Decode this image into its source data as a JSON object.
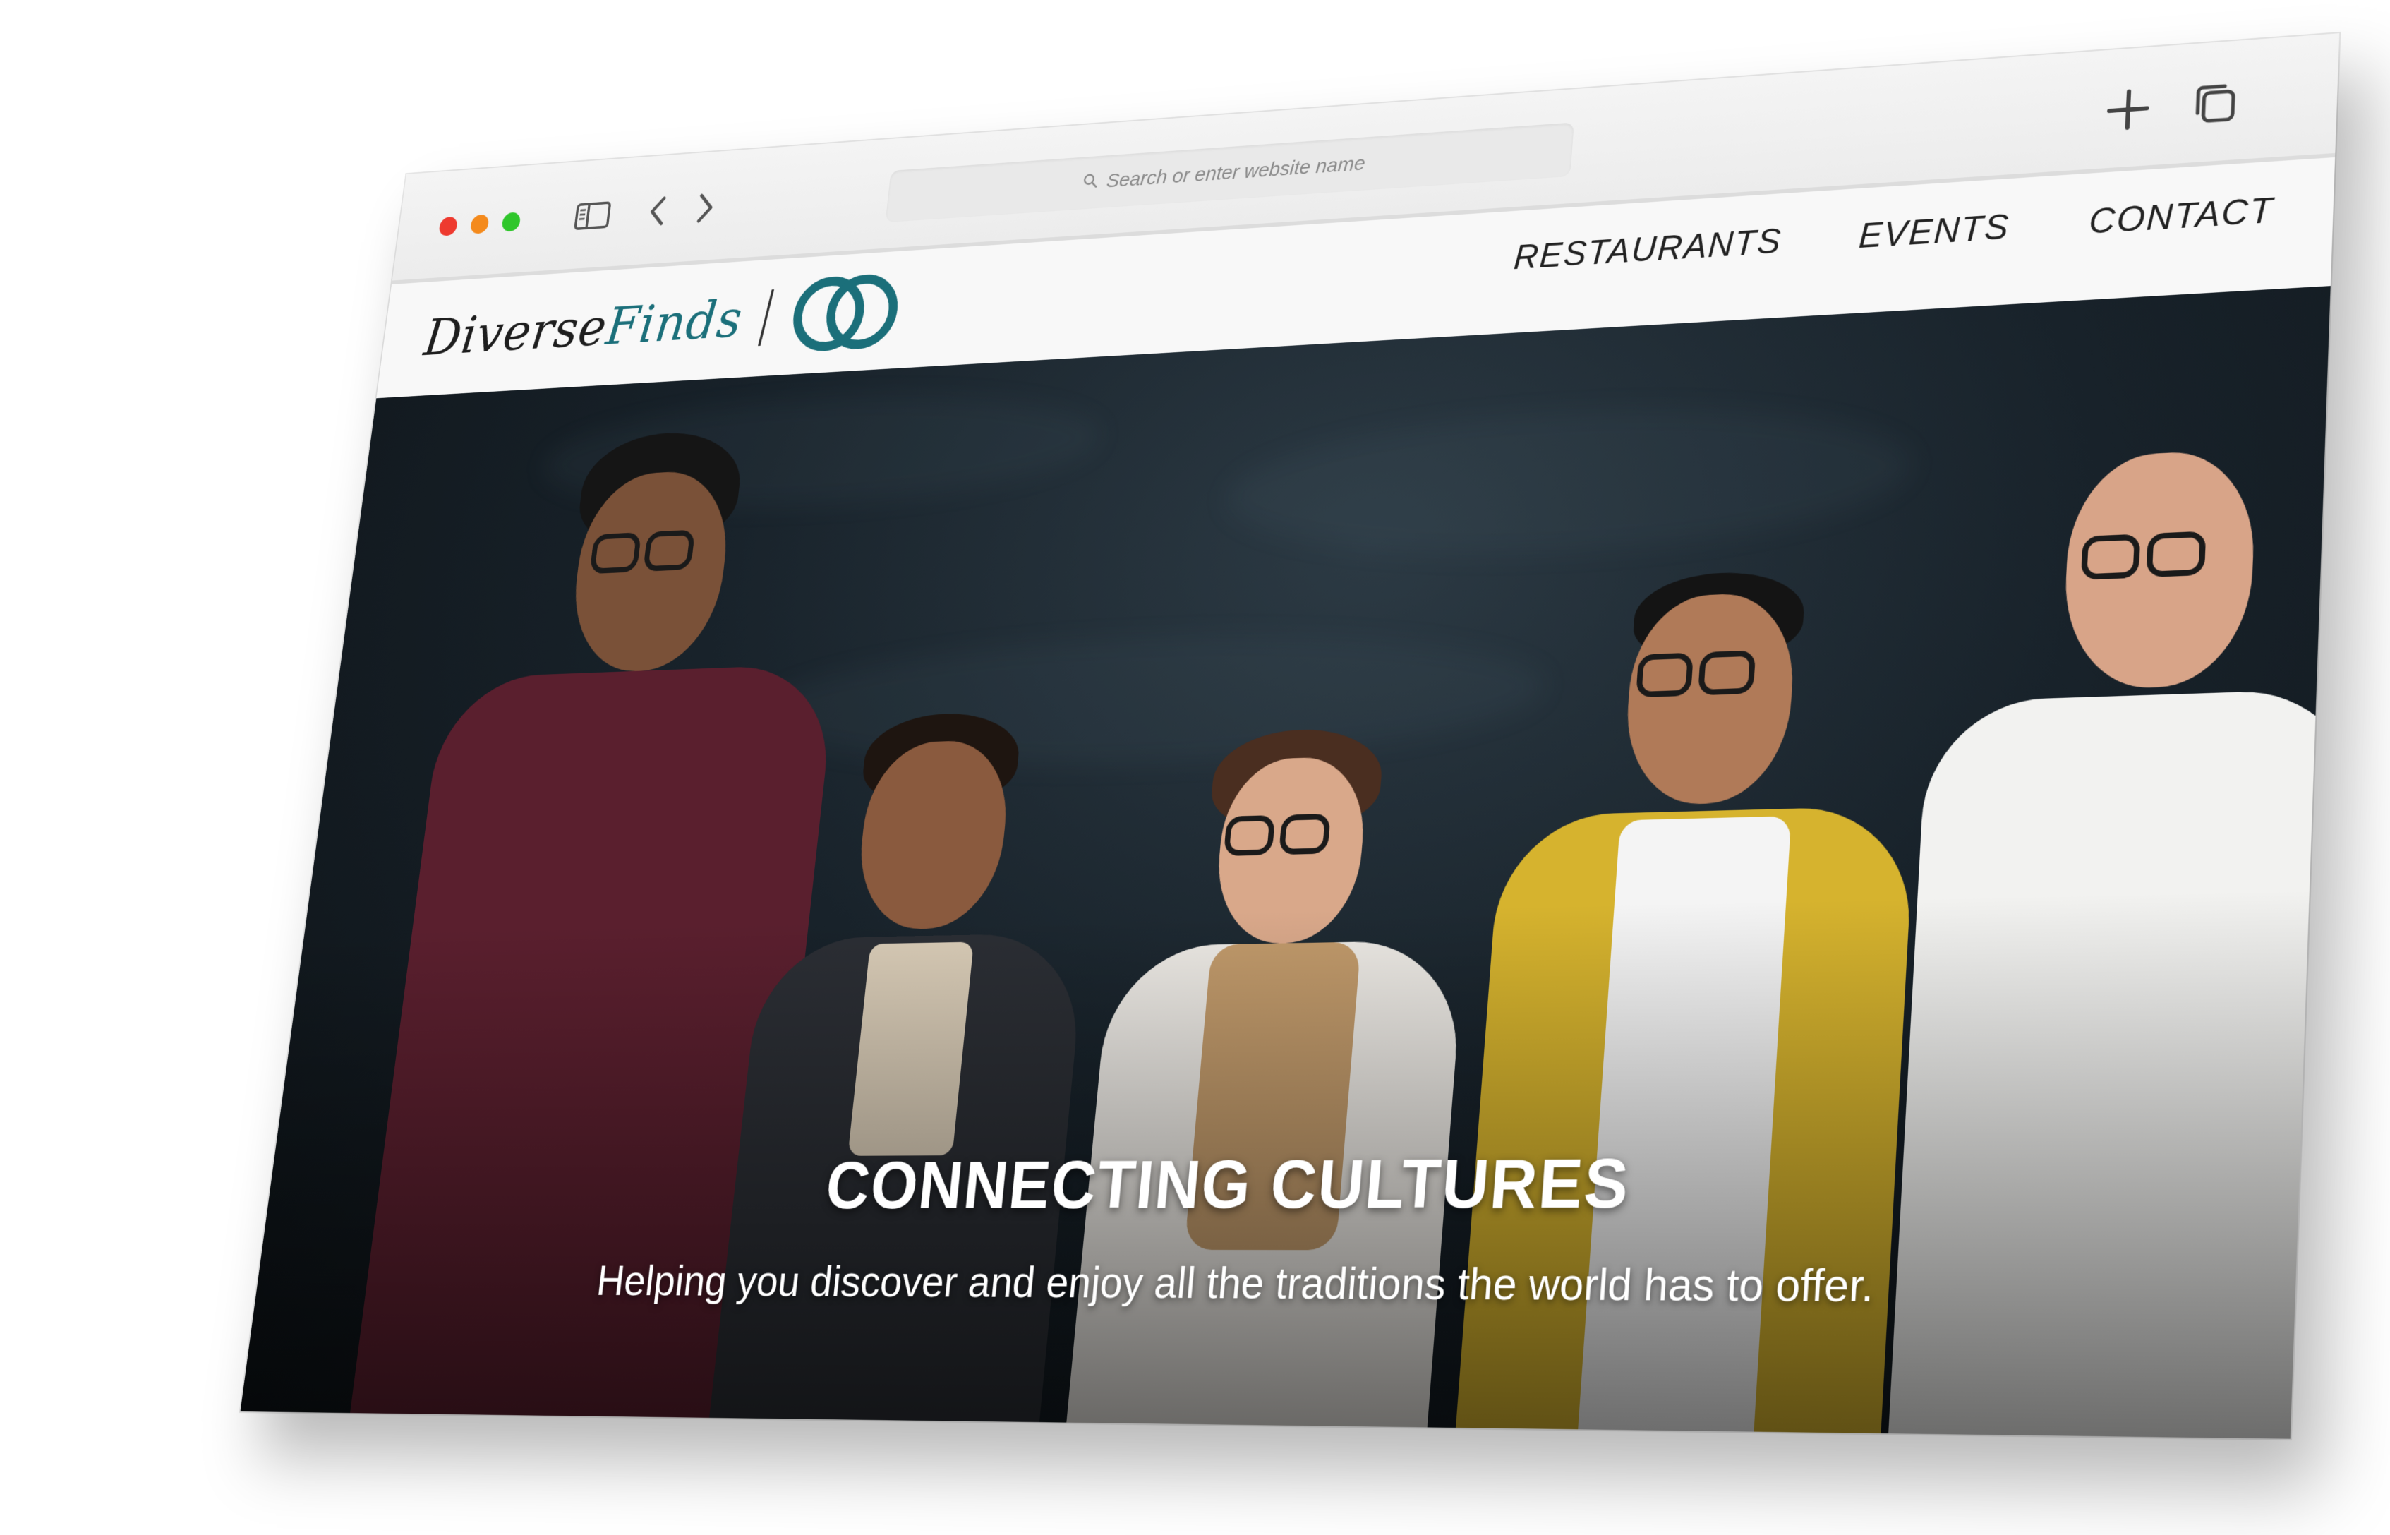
{
  "browser": {
    "search_placeholder": "Search or enter website name",
    "icons": [
      "sidebar-icon",
      "back-icon",
      "forward-icon",
      "search-icon",
      "new-tab-icon",
      "tab-overview-icon"
    ]
  },
  "site": {
    "logo_word_1": "Diverse",
    "logo_word_2": "Finds",
    "nav": {
      "restaurants": "RESTAURANTS",
      "events": "EVENTS",
      "contact": "CONTACT"
    }
  },
  "hero": {
    "title": "CONNECTING CULTURES",
    "subtitle": "Helping you discover and enjoy all the traditions the world has to offer."
  },
  "colors": {
    "brand_teal": "#1b6f7a",
    "text_dark": "#222222",
    "hero_bg": "#18222a",
    "traffic_red": "#ee3a2f",
    "traffic_orange": "#f48a1c",
    "traffic_green": "#2fc62b"
  }
}
